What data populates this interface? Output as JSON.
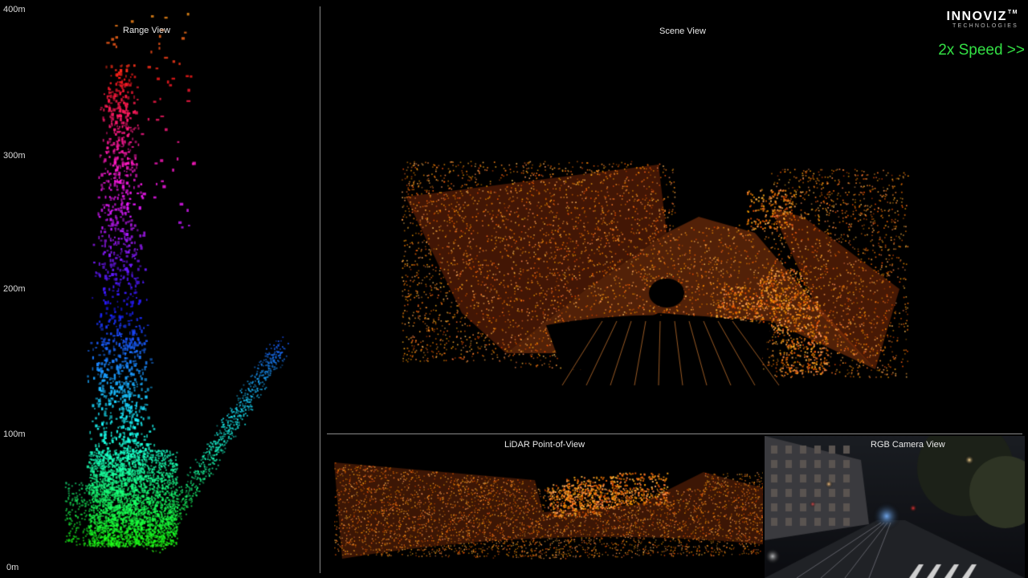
{
  "range_view": {
    "title": "Range View",
    "axis_ticks": [
      "400m",
      "300m",
      "200m",
      "100m",
      "0m"
    ]
  },
  "scene_view": {
    "title": "Scene View"
  },
  "logo": {
    "word": "INNOVIZ",
    "tm": "TM",
    "sub": "TECHNOLOGIES"
  },
  "speed": {
    "label": "2x Speed >>",
    "color": "#33e044"
  },
  "lidar_pov": {
    "title": "LiDAR Point-of-View"
  },
  "rgb_camera": {
    "title": "RGB Camera View"
  },
  "colors": {
    "background": "#000000",
    "divider": "#8a8a8a",
    "lidar_warm": "#ff9a2e",
    "speed_green": "#33e044"
  }
}
